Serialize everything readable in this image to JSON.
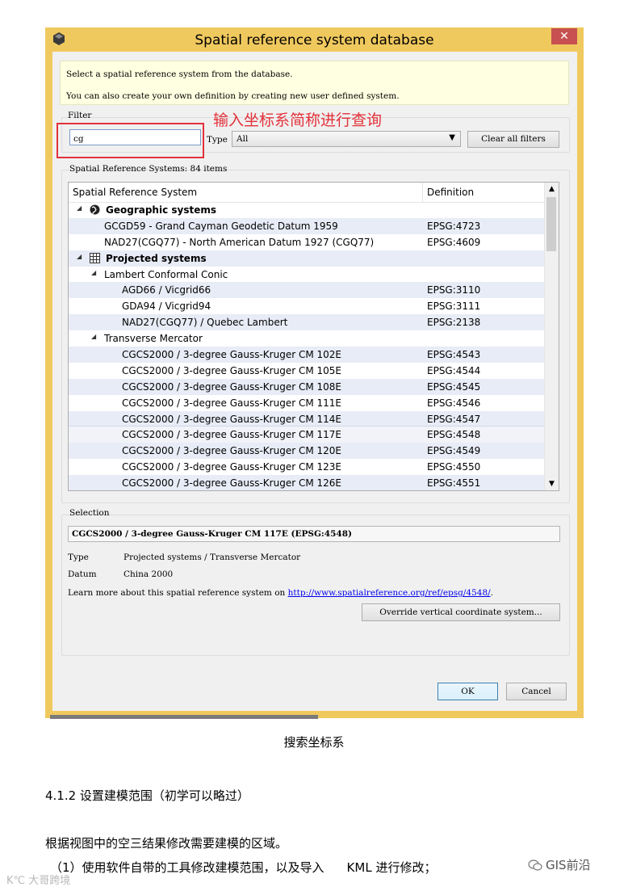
{
  "window": {
    "title": "Spatial reference system database",
    "close_glyph": "✕"
  },
  "info": {
    "line1": "Select a spatial reference system from the database.",
    "line2": "You can also create your own definition by creating new user defined system."
  },
  "filter": {
    "group_label": "Filter",
    "search_value": "cg",
    "annotation": "输入坐标系简称进行查询",
    "type_label": "Type",
    "type_value": "All",
    "clear_button": "Clear all filters"
  },
  "systems": {
    "group_label": "Spatial Reference Systems: 84 items",
    "columns": [
      "Spatial Reference System",
      "Definition"
    ],
    "rows": [
      {
        "name": "Geographic systems",
        "def": "",
        "level": 0,
        "kind": "category",
        "icon": "globe-icon",
        "expanded": true
      },
      {
        "name": "GCGD59 - Grand Cayman Geodetic Datum 1959",
        "def": "EPSG:4723",
        "level": 1,
        "kind": "item"
      },
      {
        "name": "NAD27(CGQ77) - North American Datum 1927 (CGQ77)",
        "def": "EPSG:4609",
        "level": 1,
        "kind": "item"
      },
      {
        "name": "Projected systems",
        "def": "",
        "level": 0,
        "kind": "category",
        "icon": "grid-icon",
        "expanded": true
      },
      {
        "name": "Lambert Conformal Conic",
        "def": "",
        "level": 1,
        "kind": "group",
        "expanded": true
      },
      {
        "name": "AGD66 / Vicgrid66",
        "def": "EPSG:3110",
        "level": 2,
        "kind": "item"
      },
      {
        "name": "GDA94 / Vicgrid94",
        "def": "EPSG:3111",
        "level": 2,
        "kind": "item"
      },
      {
        "name": "NAD27(CGQ77) / Quebec Lambert",
        "def": "EPSG:2138",
        "level": 2,
        "kind": "item"
      },
      {
        "name": "Transverse Mercator",
        "def": "",
        "level": 1,
        "kind": "group",
        "expanded": true
      },
      {
        "name": "CGCS2000 / 3-degree Gauss-Kruger CM 102E",
        "def": "EPSG:4543",
        "level": 2,
        "kind": "item"
      },
      {
        "name": "CGCS2000 / 3-degree Gauss-Kruger CM 105E",
        "def": "EPSG:4544",
        "level": 2,
        "kind": "item"
      },
      {
        "name": "CGCS2000 / 3-degree Gauss-Kruger CM 108E",
        "def": "EPSG:4545",
        "level": 2,
        "kind": "item"
      },
      {
        "name": "CGCS2000 / 3-degree Gauss-Kruger CM 111E",
        "def": "EPSG:4546",
        "level": 2,
        "kind": "item"
      },
      {
        "name": "CGCS2000 / 3-degree Gauss-Kruger CM 114E",
        "def": "EPSG:4547",
        "level": 2,
        "kind": "item"
      },
      {
        "name": "CGCS2000 / 3-degree Gauss-Kruger CM 117E",
        "def": "EPSG:4548",
        "level": 2,
        "kind": "item",
        "selected": true
      },
      {
        "name": "CGCS2000 / 3-degree Gauss-Kruger CM 120E",
        "def": "EPSG:4549",
        "level": 2,
        "kind": "item"
      },
      {
        "name": "CGCS2000 / 3-degree Gauss-Kruger CM 123E",
        "def": "EPSG:4550",
        "level": 2,
        "kind": "item"
      },
      {
        "name": "CGCS2000 / 3-degree Gauss-Kruger CM 126E",
        "def": "EPSG:4551",
        "level": 2,
        "kind": "item"
      }
    ]
  },
  "selection": {
    "group_label": "Selection",
    "name": "CGCS2000 / 3-degree Gauss-Kruger CM 117E (EPSG:4548)",
    "type_key": "Type",
    "type_value": "Projected systems / Transverse Mercator",
    "datum_key": "Datum",
    "datum_value": "China 2000",
    "learn_more_prefix": "Learn more about this spatial reference system on ",
    "learn_more_link": "http://www.spatialreference.org/ref/epsg/4548/",
    "learn_more_suffix": ".",
    "override_button": "Override vertical coordinate system..."
  },
  "buttons": {
    "ok": "OK",
    "cancel": "Cancel"
  },
  "article": {
    "caption": "搜索坐标系",
    "section_heading": "4.1.2  设置建模范围（初学可以略过）",
    "para1": "根据视图中的空三结果修改需要建模的区域。",
    "para2_a": "（1）使用软件自带的工具修改建模范围，以及导入",
    "para2_b": "KML 进行修改；",
    "watermark_left": "K℃ 大哥跨境",
    "watermark_right": "GIS前沿"
  },
  "colors": {
    "window_frame": "#f0c95e",
    "close_button": "#c75050",
    "info_background": "#ffffe1",
    "annotation_red": "#e3323a",
    "row_alternate": "#e8ecf6",
    "link": "#0000ee"
  }
}
